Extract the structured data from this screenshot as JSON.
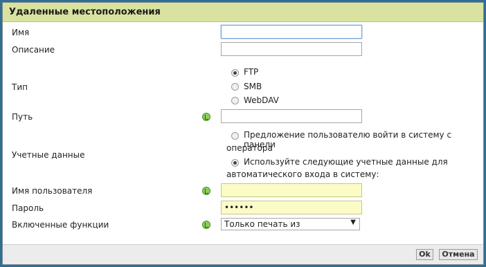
{
  "dialog": {
    "title": "Удаленные местоположения"
  },
  "fields": {
    "name_label": "Имя",
    "description_label": "Описание",
    "type_label": "Тип",
    "type_options": [
      "FTP",
      "SMB",
      "WebDAV"
    ],
    "type_selected": "FTP",
    "path_label": "Путь",
    "credentials_label": "Учетные данные",
    "credentials_option1_line1": "Предложение пользователю войти в систему с панели",
    "credentials_option1_line2": "оператора",
    "credentials_option2_line1": "Используйте следующие учетные данные для",
    "credentials_option2_line2": "автоматического входа в систему:",
    "credentials_selected": "option2",
    "username_label": "Имя пользователя",
    "password_label": "Пароль",
    "password_value": "••••••",
    "functions_label": "Включенные функции",
    "functions_value": "Только печать из"
  },
  "footer": {
    "ok_label": "Ok",
    "cancel_label": "Отмена"
  },
  "colors": {
    "titlebar": "#d9e39f",
    "outer_background": "#2f6f93",
    "input_highlight": "#fbfbc6",
    "help_icon": "#8bcf5a"
  }
}
